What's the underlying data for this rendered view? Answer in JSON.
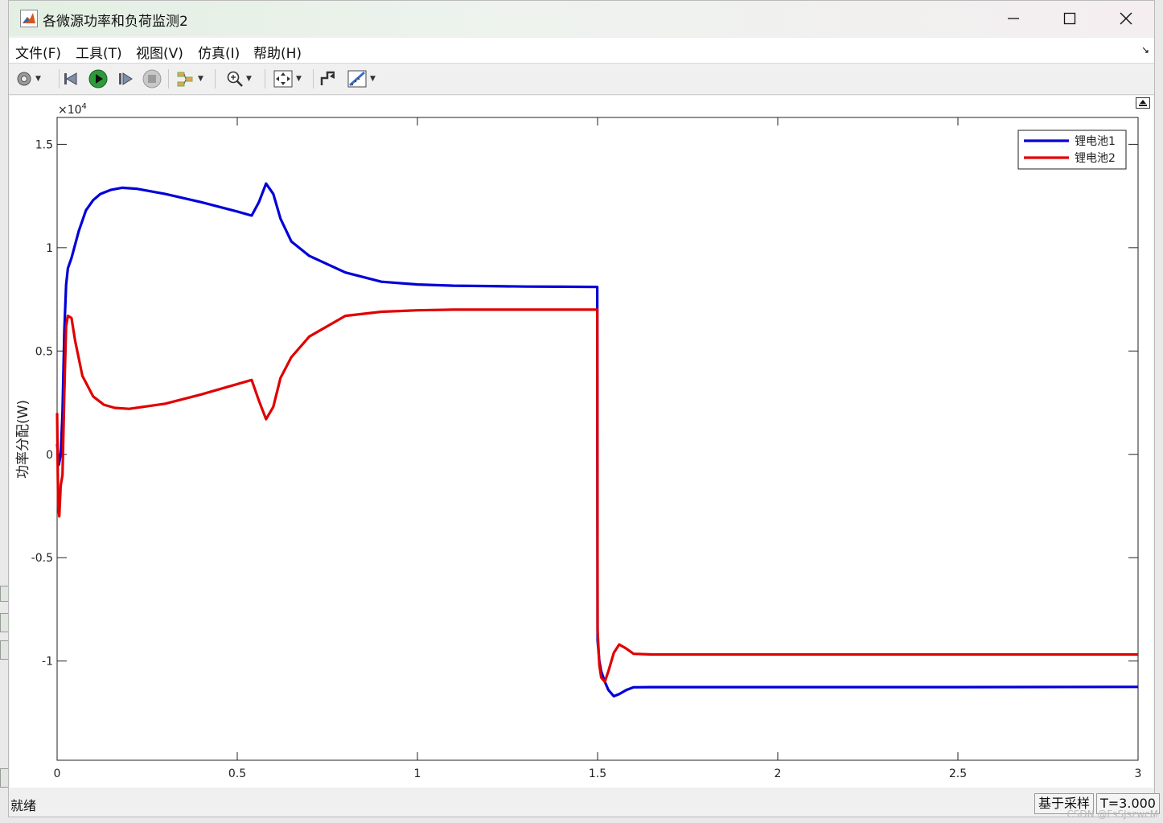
{
  "window": {
    "title": "各微源功率和负荷监测2",
    "controls": {
      "minimize": "—",
      "maximize": "☐",
      "close": "✕"
    }
  },
  "menu": [
    "文件(F)",
    "工具(T)",
    "视图(V)",
    "仿真(I)",
    "帮助(H)"
  ],
  "toolbar": {
    "buttons": [
      "settings-icon",
      "step-back-icon",
      "run-icon",
      "step-forward-icon",
      "stop-icon",
      "signal-select-icon",
      "zoom-icon",
      "fit-view-icon",
      "style-icon",
      "measure-icon"
    ]
  },
  "status": {
    "ready": "就绪",
    "mode": "基于采样",
    "time": "T=3.000"
  },
  "watermark": "CSDN @FsSJszwcM",
  "chart_data": {
    "type": "line",
    "title": "",
    "xlabel": "",
    "ylabel": "功率分配(W)",
    "y_exponent_label": "×10",
    "y_exponent_power": "4",
    "xlim": [
      0,
      3
    ],
    "ylim": [
      -1.48,
      1.63
    ],
    "xticks": [
      0,
      0.5,
      1,
      1.5,
      2,
      2.5,
      3
    ],
    "xtick_labels": [
      "0",
      "0.5",
      "1",
      "1.5",
      "2",
      "2.5",
      "3"
    ],
    "yticks": [
      1.5,
      1,
      0.5,
      0,
      -0.5,
      -1
    ],
    "ytick_labels": [
      "1.5",
      "1",
      "0.5",
      "0",
      "-0.5",
      "-1"
    ],
    "grid": false,
    "legend_position": "top-right",
    "series": [
      {
        "name": "锂电池1",
        "color": "#0000d8",
        "x": [
          0,
          0.005,
          0.01,
          0.015,
          0.02,
          0.025,
          0.03,
          0.04,
          0.06,
          0.08,
          0.1,
          0.12,
          0.15,
          0.18,
          0.22,
          0.3,
          0.4,
          0.5,
          0.54,
          0.56,
          0.58,
          0.6,
          0.62,
          0.65,
          0.7,
          0.8,
          0.9,
          1.0,
          1.1,
          1.2,
          1.3,
          1.4,
          1.499,
          1.5,
          1.505,
          1.51,
          1.52,
          1.53,
          1.545,
          1.56,
          1.58,
          1.6,
          1.65,
          1.7,
          2.0,
          2.5,
          3.0
        ],
        "y": [
          0.05,
          -0.05,
          0.0,
          0.2,
          0.6,
          0.82,
          0.9,
          0.95,
          1.08,
          1.18,
          1.23,
          1.26,
          1.28,
          1.29,
          1.285,
          1.26,
          1.22,
          1.175,
          1.155,
          1.22,
          1.31,
          1.26,
          1.14,
          1.03,
          0.96,
          0.88,
          0.835,
          0.822,
          0.816,
          0.814,
          0.812,
          0.811,
          0.81,
          -0.9,
          -1.0,
          -1.05,
          -1.1,
          -1.14,
          -1.17,
          -1.16,
          -1.14,
          -1.127,
          -1.126,
          -1.126,
          -1.126,
          -1.126,
          -1.125
        ]
      },
      {
        "name": "锂电池2",
        "color": "#e00000",
        "x": [
          0,
          0.003,
          0.006,
          0.01,
          0.015,
          0.02,
          0.025,
          0.03,
          0.04,
          0.05,
          0.07,
          0.1,
          0.13,
          0.16,
          0.2,
          0.3,
          0.4,
          0.5,
          0.54,
          0.56,
          0.58,
          0.6,
          0.62,
          0.65,
          0.7,
          0.8,
          0.9,
          1.0,
          1.1,
          1.2,
          1.3,
          1.4,
          1.499,
          1.5,
          1.505,
          1.51,
          1.52,
          1.53,
          1.545,
          1.56,
          1.58,
          1.6,
          1.65,
          1.7,
          2.0,
          2.5,
          3.0
        ],
        "y": [
          0.2,
          -0.25,
          -0.3,
          -0.15,
          -0.1,
          0.3,
          0.62,
          0.67,
          0.66,
          0.55,
          0.38,
          0.28,
          0.24,
          0.225,
          0.22,
          0.245,
          0.29,
          0.34,
          0.36,
          0.26,
          0.17,
          0.23,
          0.37,
          0.47,
          0.57,
          0.67,
          0.69,
          0.697,
          0.7,
          0.7,
          0.7,
          0.7,
          0.7,
          -0.85,
          -1.02,
          -1.08,
          -1.1,
          -1.05,
          -0.96,
          -0.92,
          -0.94,
          -0.965,
          -0.968,
          -0.968,
          -0.968,
          -0.968,
          -0.968
        ]
      }
    ]
  }
}
